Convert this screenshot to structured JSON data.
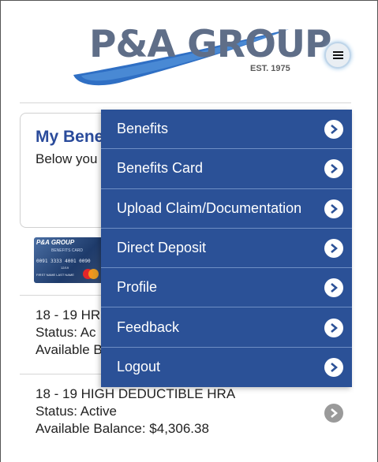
{
  "header": {
    "logo_text": "P&A GROUP",
    "logo_tagline": "EST. 1975",
    "menu_icon": "hamburger-icon"
  },
  "benefits": {
    "title": "My Bene",
    "text": "Below you you are cu find more"
  },
  "card": {
    "brand": "P&A GROUP",
    "subtitle": "BENEFITS CARD",
    "number": "0091 3333 4001 0090",
    "expiry": "12/19",
    "holder": "FIRST NAME LAST NAME",
    "network_icon": "mastercard-icon"
  },
  "accounts": [
    {
      "name": "18 - 19 HR",
      "status": "Status: Ac",
      "balance": "Available B"
    },
    {
      "name": "18 - 19 HIGH DEDUCTIBLE HRA",
      "status": "Status: Active",
      "balance": "Available Balance: $4,306.38"
    }
  ],
  "menu": {
    "items": [
      {
        "label": "Benefits"
      },
      {
        "label": "Benefits Card"
      },
      {
        "label": "Upload Claim/Documentation"
      },
      {
        "label": "Direct Deposit"
      },
      {
        "label": "Profile"
      },
      {
        "label": "Feedback"
      },
      {
        "label": "Logout"
      }
    ]
  },
  "colors": {
    "menu_bg": "#2b5197",
    "title_blue": "#2a4b9b",
    "logo_gray": "#5f6e88"
  }
}
